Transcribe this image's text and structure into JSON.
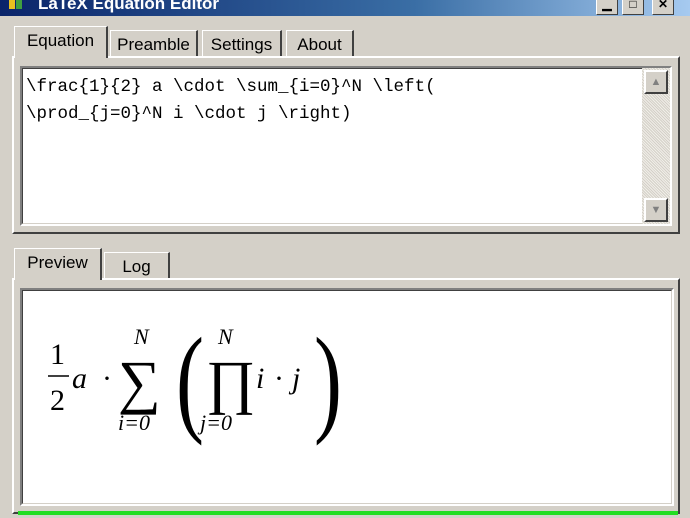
{
  "window": {
    "title": "LaTeX Equation Editor"
  },
  "tabs_top": [
    {
      "label": "Equation",
      "active": true
    },
    {
      "label": "Preamble",
      "active": false
    },
    {
      "label": "Settings",
      "active": false
    },
    {
      "label": "About",
      "active": false
    }
  ],
  "editor": {
    "lines": [
      "\\frac{1}{2} a \\cdot \\sum_{i=0}^N \\left(",
      "\\prod_{j=0}^N i \\cdot j \\right)"
    ]
  },
  "tabs_bottom": [
    {
      "label": "Preview",
      "active": true
    },
    {
      "label": "Log",
      "active": false
    }
  ],
  "preview": {
    "frac_num": "1",
    "frac_den": "2",
    "var_a": "a",
    "cdot1": "·",
    "sum_symbol": "∑",
    "sum_upper": "N",
    "sum_lower": "i=0",
    "left_paren": "(",
    "prod_symbol": "∏",
    "prod_upper": "N",
    "prod_lower": "j=0",
    "var_i": "i",
    "cdot2": "·",
    "var_j": "j",
    "right_paren": ")"
  },
  "colors": {
    "accent_bar": "#22dd22",
    "title_bar": "#0a246a"
  },
  "icons": {
    "app": "app-icon",
    "minimize": "minimize-icon",
    "maximize": "maximize-icon",
    "close": "close-icon"
  }
}
